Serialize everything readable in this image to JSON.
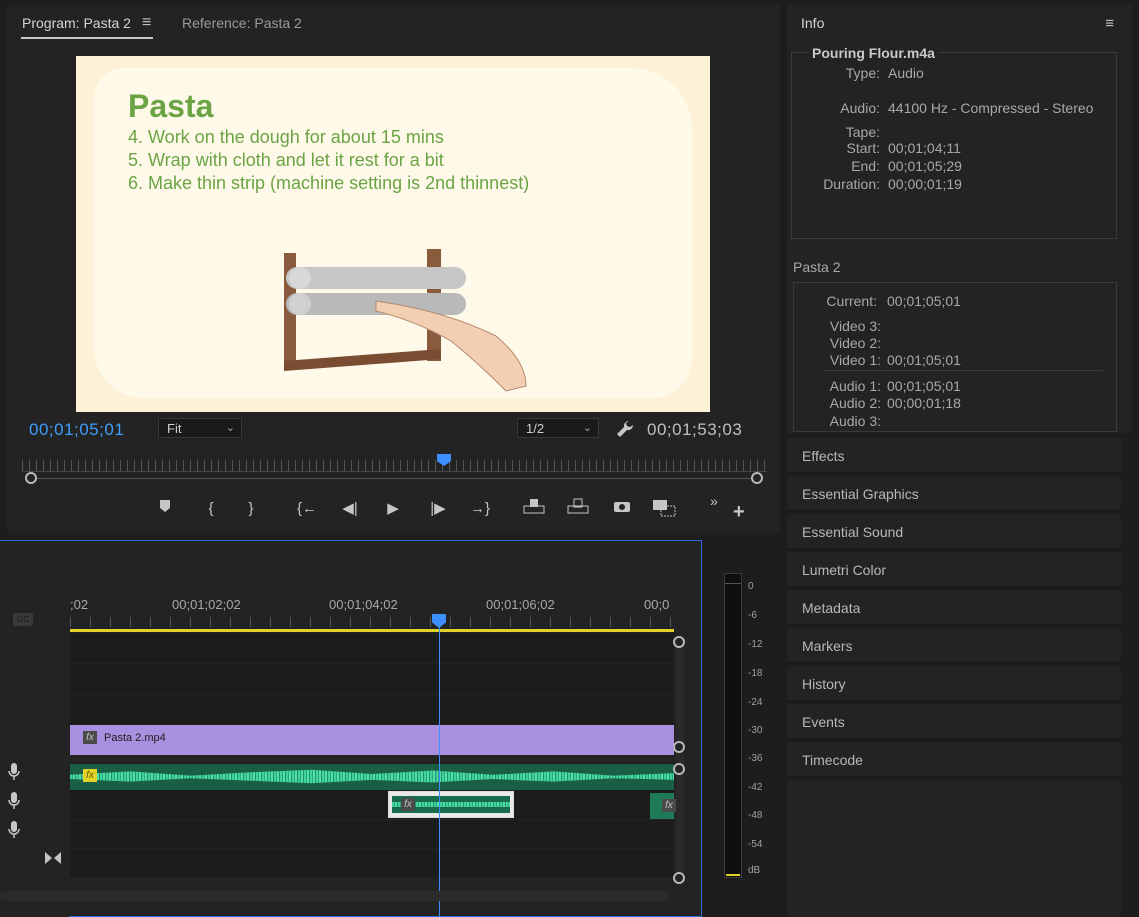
{
  "program_monitor": {
    "tab_program": "Program: Pasta 2",
    "tab_reference": "Reference: Pasta 2",
    "menu_icon": "hamburger-icon",
    "slide": {
      "title": "Pasta",
      "steps": [
        "4. Work on the dough for about 15 mins",
        "5. Wrap with cloth and let it rest for a bit",
        "6. Make thin strip (machine setting is 2nd thinnest)"
      ]
    },
    "current_timecode": "00;01;05;01",
    "zoom_select": "Fit",
    "resolution_select": "1/2",
    "duration_timecode": "00;01;53;03",
    "playhead_fraction": 0.57
  },
  "timeline": {
    "ruler_labels": [
      ";02",
      "00;01;02;02",
      "00;01;04;02",
      "00;01;06;02",
      "00;0"
    ],
    "cc_label": "CC",
    "video_clip": "Pasta 2.mp4"
  },
  "audio_meter": {
    "db_labels": [
      "0",
      "-6",
      "-12",
      "-18",
      "-24",
      "-30",
      "-36",
      "-42",
      "-48",
      "-54",
      "dB"
    ]
  },
  "info": {
    "title": "Info",
    "clip_name": "Pouring Flour.m4a",
    "type_label": "Type:",
    "type_value": "Audio",
    "audio_label": "Audio:",
    "audio_value": "44100 Hz - Compressed - Stereo",
    "tape_label": "Tape:",
    "start_label": "Start:",
    "start_value": "00;01;04;11",
    "end_label": "End:",
    "end_value": "00;01;05;29",
    "duration_label": "Duration:",
    "duration_value": "00;00;01;19",
    "sequence_name": "Pasta 2",
    "current_label": "Current:",
    "current_value": "00;01;05;01",
    "video3_label": "Video 3:",
    "video2_label": "Video 2:",
    "video1_label": "Video 1:",
    "video1_value": "00;01;05;01",
    "audio1_label": "Audio 1:",
    "audio1_value": "00;01;05;01",
    "audio2_label": "Audio 2:",
    "audio2_value": "00;00;01;18",
    "audio3_label": "Audio 3:"
  },
  "side_panels": [
    "Effects",
    "Essential Graphics",
    "Essential Sound",
    "Lumetri Color",
    "Metadata",
    "Markers",
    "History",
    "Events",
    "Timecode"
  ],
  "colors": {
    "accent": "#3d9eff",
    "video_clip": "#a88fe0",
    "audio_clip": "#3fd29a",
    "work_area": "#e3d328"
  }
}
